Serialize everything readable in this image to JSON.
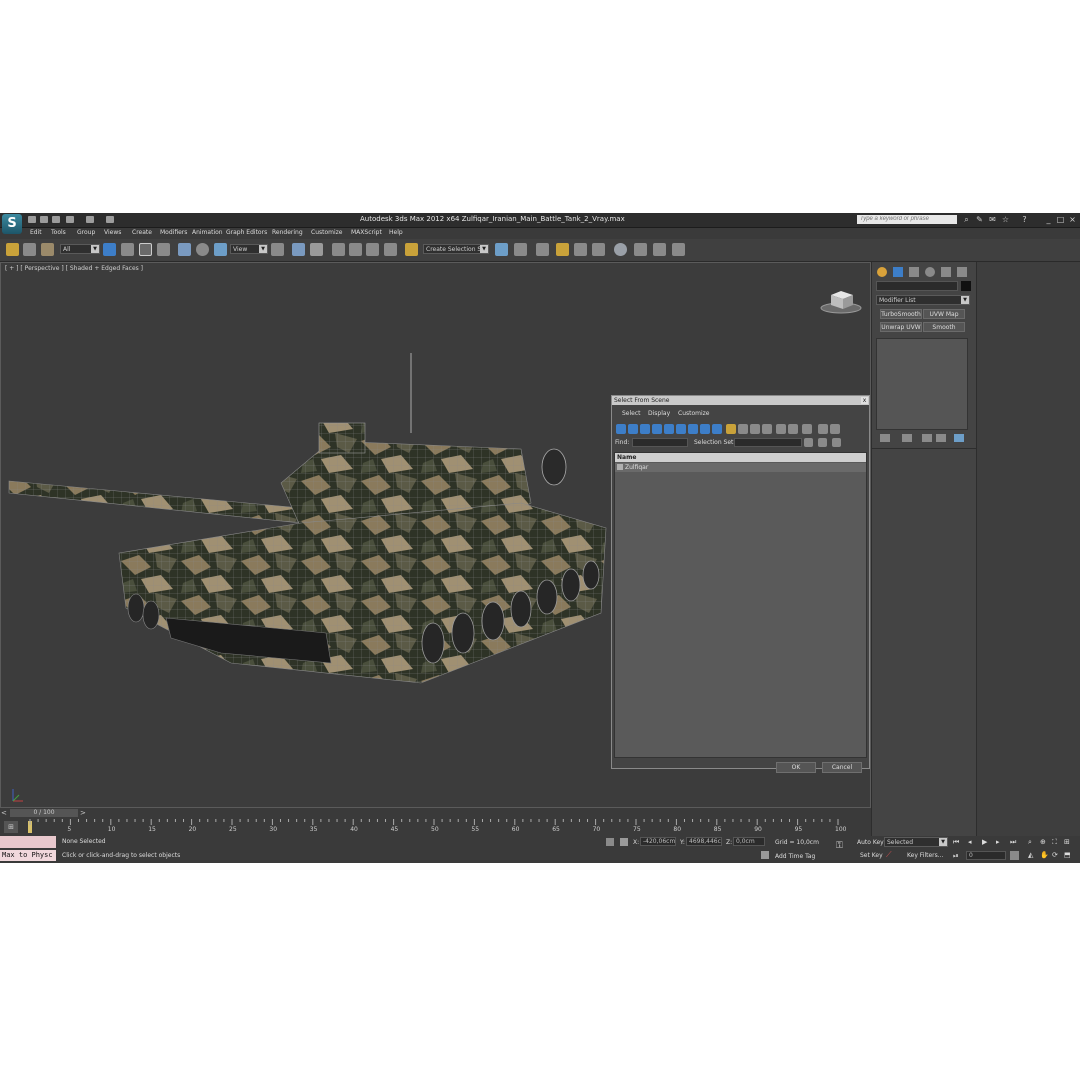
{
  "window": {
    "title": "Autodesk 3ds Max  2012 x64      Zulfiqar_Iranian_Main_Battle_Tank_2_Vray.max",
    "logo_text": "S",
    "search_placeholder": "Type a keyword or phrase"
  },
  "menu": [
    "Edit",
    "Tools",
    "Group",
    "Views",
    "Create",
    "Modifiers",
    "Animation",
    "Graph Editors",
    "Rendering",
    "Customize",
    "MAXScript",
    "Help"
  ],
  "toolbar": {
    "filter_value": "All",
    "refcoord_value": "View",
    "selection_set_value": "Create Selection Se"
  },
  "viewport": {
    "label": "[ + ] [ Perspective ] [ Shaded + Edged Faces ]"
  },
  "timeline": {
    "frame_counter": "0 / 100",
    "ticks": [
      "0",
      "5",
      "10",
      "15",
      "20",
      "25",
      "30",
      "35",
      "40",
      "45",
      "50",
      "55",
      "60",
      "65",
      "70",
      "75",
      "80",
      "85",
      "90",
      "95",
      "100"
    ]
  },
  "status": {
    "maxscript": "Max to Physc",
    "selection": "None Selected",
    "prompt": "Click or click-and-drag to select objects",
    "x_label": "X:",
    "x_value": "-420,06cm",
    "y_label": "Y:",
    "y_value": "4698,446cr",
    "z_label": "Z:",
    "z_value": "0,0cm",
    "grid": "Grid = 10,0cm",
    "add_time_tag": "Add Time Tag",
    "auto_key": "Auto Key",
    "set_key": "Set Key",
    "key_mode": "Selected",
    "key_filters": "Key Filters...",
    "frame_value": "0"
  },
  "command_panel": {
    "modifier_list": "Modifier List",
    "buttons": [
      "TurboSmooth",
      "UVW Map",
      "Unwrap UVW",
      "Smooth"
    ]
  },
  "dialog": {
    "title": "Select From Scene",
    "close": "x",
    "menu": [
      "Select",
      "Display",
      "Customize"
    ],
    "find_label": "Find:",
    "selection_set_label": "Selection Set:",
    "column_name": "Name",
    "items": [
      "Zulfiqar"
    ],
    "ok": "OK",
    "cancel": "Cancel"
  },
  "colors": {
    "ui_background": "#444444",
    "viewport_background": "#3c3c3c",
    "accent_blue": "#3d7ec8",
    "camo_tan": "#8a7a5c",
    "camo_dark": "#2e3326"
  }
}
